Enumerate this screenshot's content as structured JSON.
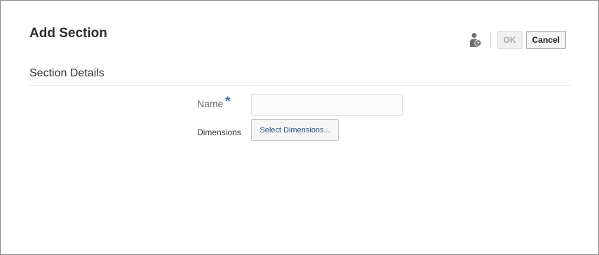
{
  "dialog": {
    "title": "Add Section",
    "help_icon": "user-help-icon",
    "ok_label": "OK",
    "cancel_label": "Cancel"
  },
  "section": {
    "header": "Section Details"
  },
  "form": {
    "name_label": "Name",
    "required_marker": "*",
    "name_value": "",
    "dimensions_label": "Dimensions",
    "select_dimensions_label": "Select Dimensions..."
  },
  "colors": {
    "required": "#3b76c0",
    "link_text": "#1e4e88",
    "ok_disabled": "#a9a9a9"
  }
}
